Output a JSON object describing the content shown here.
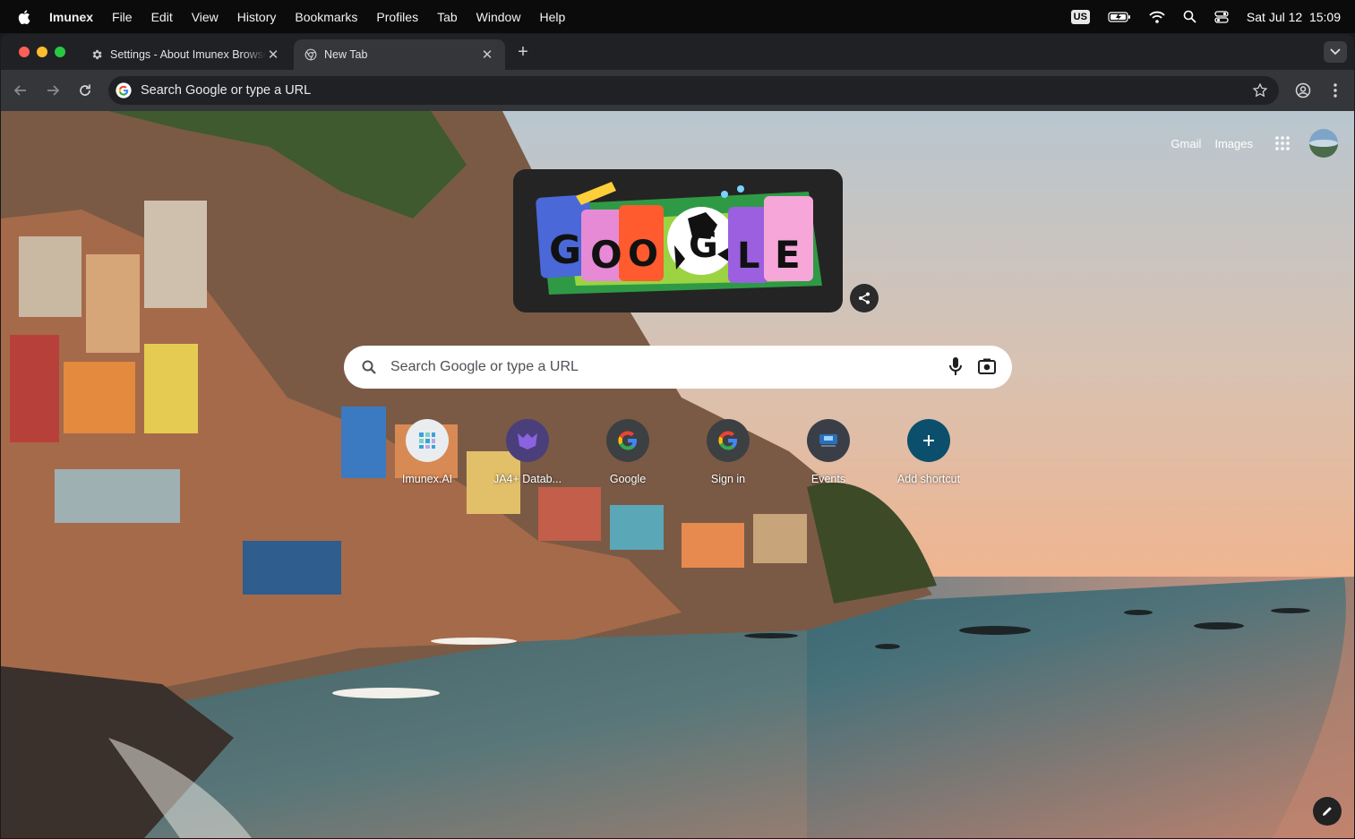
{
  "menubar": {
    "items": [
      "Imunex",
      "File",
      "Edit",
      "View",
      "History",
      "Bookmarks",
      "Profiles",
      "Tab",
      "Window",
      "Help"
    ],
    "input_source": "US",
    "datetime": "Sat Jul 12  15:09"
  },
  "tabs": [
    {
      "title": "Settings - About Imunex Browser",
      "icon": "gear-icon",
      "active": false
    },
    {
      "title": "New Tab",
      "icon": "chrome-icon",
      "active": true
    }
  ],
  "omnibox": {
    "text": "Search Google or type a URL"
  },
  "ntp": {
    "links": {
      "gmail": "Gmail",
      "images": "Images"
    },
    "search_placeholder": "Search Google or type a URL",
    "shortcuts": [
      {
        "label": "Imunex.AI",
        "icon": "imunex-icon"
      },
      {
        "label": "JA4+ Datab...",
        "icon": "ja4-icon"
      },
      {
        "label": "Google",
        "icon": "google-icon"
      },
      {
        "label": "Sign in",
        "icon": "google-icon"
      },
      {
        "label": "Events",
        "icon": "events-icon"
      },
      {
        "label": "Add shortcut",
        "icon": "plus-icon"
      }
    ],
    "doodle_letters": [
      "G",
      "O",
      "O",
      "G",
      "L",
      "E"
    ]
  },
  "colors": {
    "window_bg": "#202124",
    "toolbar_bg": "#35363a",
    "add_shortcut_bg": "#0b4f6c"
  }
}
